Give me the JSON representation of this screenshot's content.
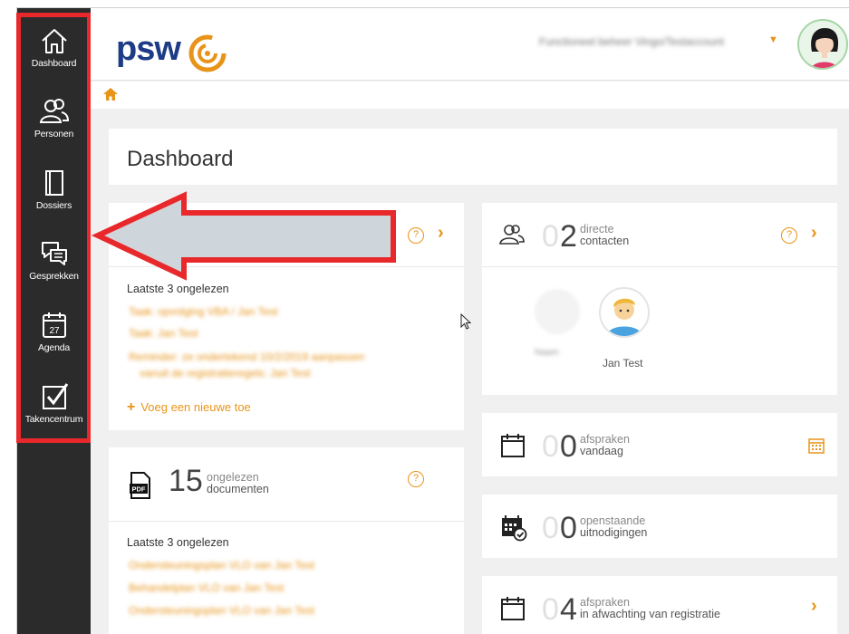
{
  "sidebar": {
    "items": [
      {
        "label": "Dashboard"
      },
      {
        "label": "Personen"
      },
      {
        "label": "Dossiers"
      },
      {
        "label": "Gesprekken"
      },
      {
        "label": "Agenda",
        "day": "27"
      },
      {
        "label": "Takencentrum"
      }
    ]
  },
  "header": {
    "logo_text": "psw",
    "user_name": "Functioneel beheer Vingo/Testaccount"
  },
  "page": {
    "title": "Dashboard"
  },
  "cards": {
    "messages": {
      "section_label": "Laatste 3 ongelezen",
      "items": [
        "Taak: opvolging VBA / Jan Test",
        "Taak: Jan Test",
        "Reminder: ze ondertekend 10/2/2019 aanpassen",
        "vanuit de registratieregels: Jan Test"
      ],
      "add_label": "Voeg een nieuwe toe"
    },
    "documents": {
      "count_prefix": "",
      "count": "15",
      "line1": "ongelezen",
      "line2": "documenten",
      "section_label": "Laatste 3 ongelezen",
      "items": [
        "Ondersteuningsplan VLO van Jan Test",
        "Behandelplan VLO van Jan Test",
        "Ondersteuningsplan VLO van Jan Test"
      ]
    },
    "contacts": {
      "count_prefix": "0",
      "count": "2",
      "line1": "directe",
      "line2": "contacten",
      "people": [
        {
          "name": "Naam"
        },
        {
          "name": "Jan Test"
        }
      ]
    },
    "appointments_today": {
      "count_prefix": "0",
      "count": "0",
      "line1": "afspraken",
      "line2": "vandaag"
    },
    "invitations": {
      "count_prefix": "0",
      "count": "0",
      "line1": "openstaande",
      "line2": "uitnodigingen"
    },
    "pending": {
      "count_prefix": "0",
      "count": "4",
      "line1": "afspraken",
      "line2": "in afwachting van registratie"
    }
  },
  "colors": {
    "accent": "#e8941a",
    "sidebar": "#2b2b2b",
    "brand": "#1d3c85",
    "highlight": "#e8282b"
  }
}
